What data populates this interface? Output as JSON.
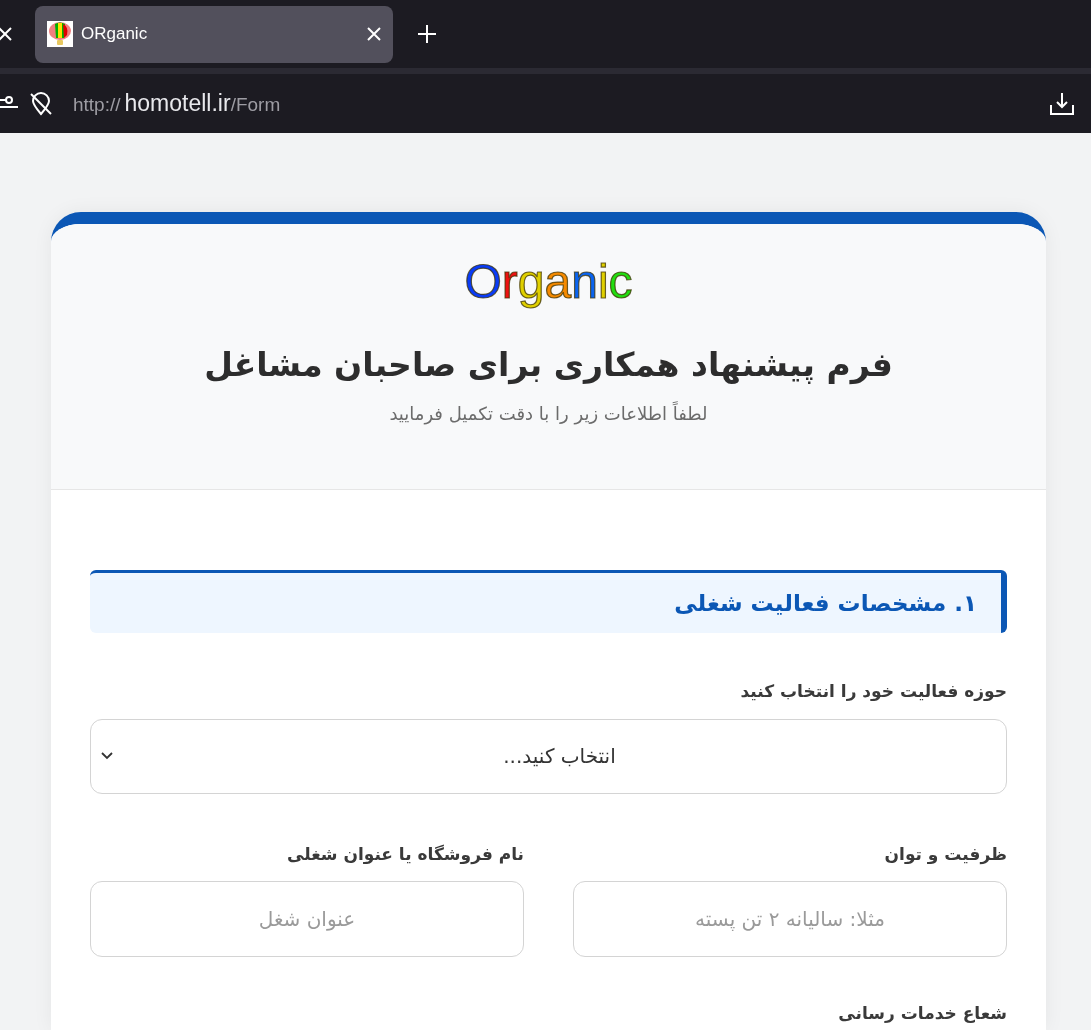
{
  "browser": {
    "tabs": [
      {
        "title": "ORganic",
        "selected": true
      }
    ],
    "url": {
      "scheme": "http://",
      "host": "homotell.ir",
      "path": "/Form"
    }
  },
  "header": {
    "logo": {
      "text": "Organic",
      "letter_colors": [
        {
          "color": "#0a3cf5"
        },
        {
          "color": "#ee1111"
        },
        {
          "color": "#e0d000"
        },
        {
          "color": "#f58a00"
        },
        {
          "color": "#0a64f0"
        },
        {
          "color": "#e0d000"
        },
        {
          "color": "#22dd11"
        }
      ]
    },
    "title": "فرم پیشنهاد همکاری برای صاحبان مشاغل",
    "subtitle": "لطفاً اطلاعات زیر را با دقت تکمیل فرمایید"
  },
  "sections": [
    {
      "title": "۱. مشخصات فعالیت شغلی",
      "fields": [
        {
          "kind": "select",
          "label": "حوزه فعالیت خود را انتخاب کنید",
          "value": "انتخاب کنید..."
        },
        {
          "kind": "pair",
          "items": [
            {
              "label": "ظرفیت و توان",
              "placeholder": "مثلا: سالیانه ۲ تن پسته"
            },
            {
              "label": "نام فروشگاه یا عنوان شغلی",
              "placeholder": "عنوان شغل"
            }
          ]
        },
        {
          "kind": "label",
          "label": "شعاع خدمات رسانی"
        }
      ]
    }
  ]
}
